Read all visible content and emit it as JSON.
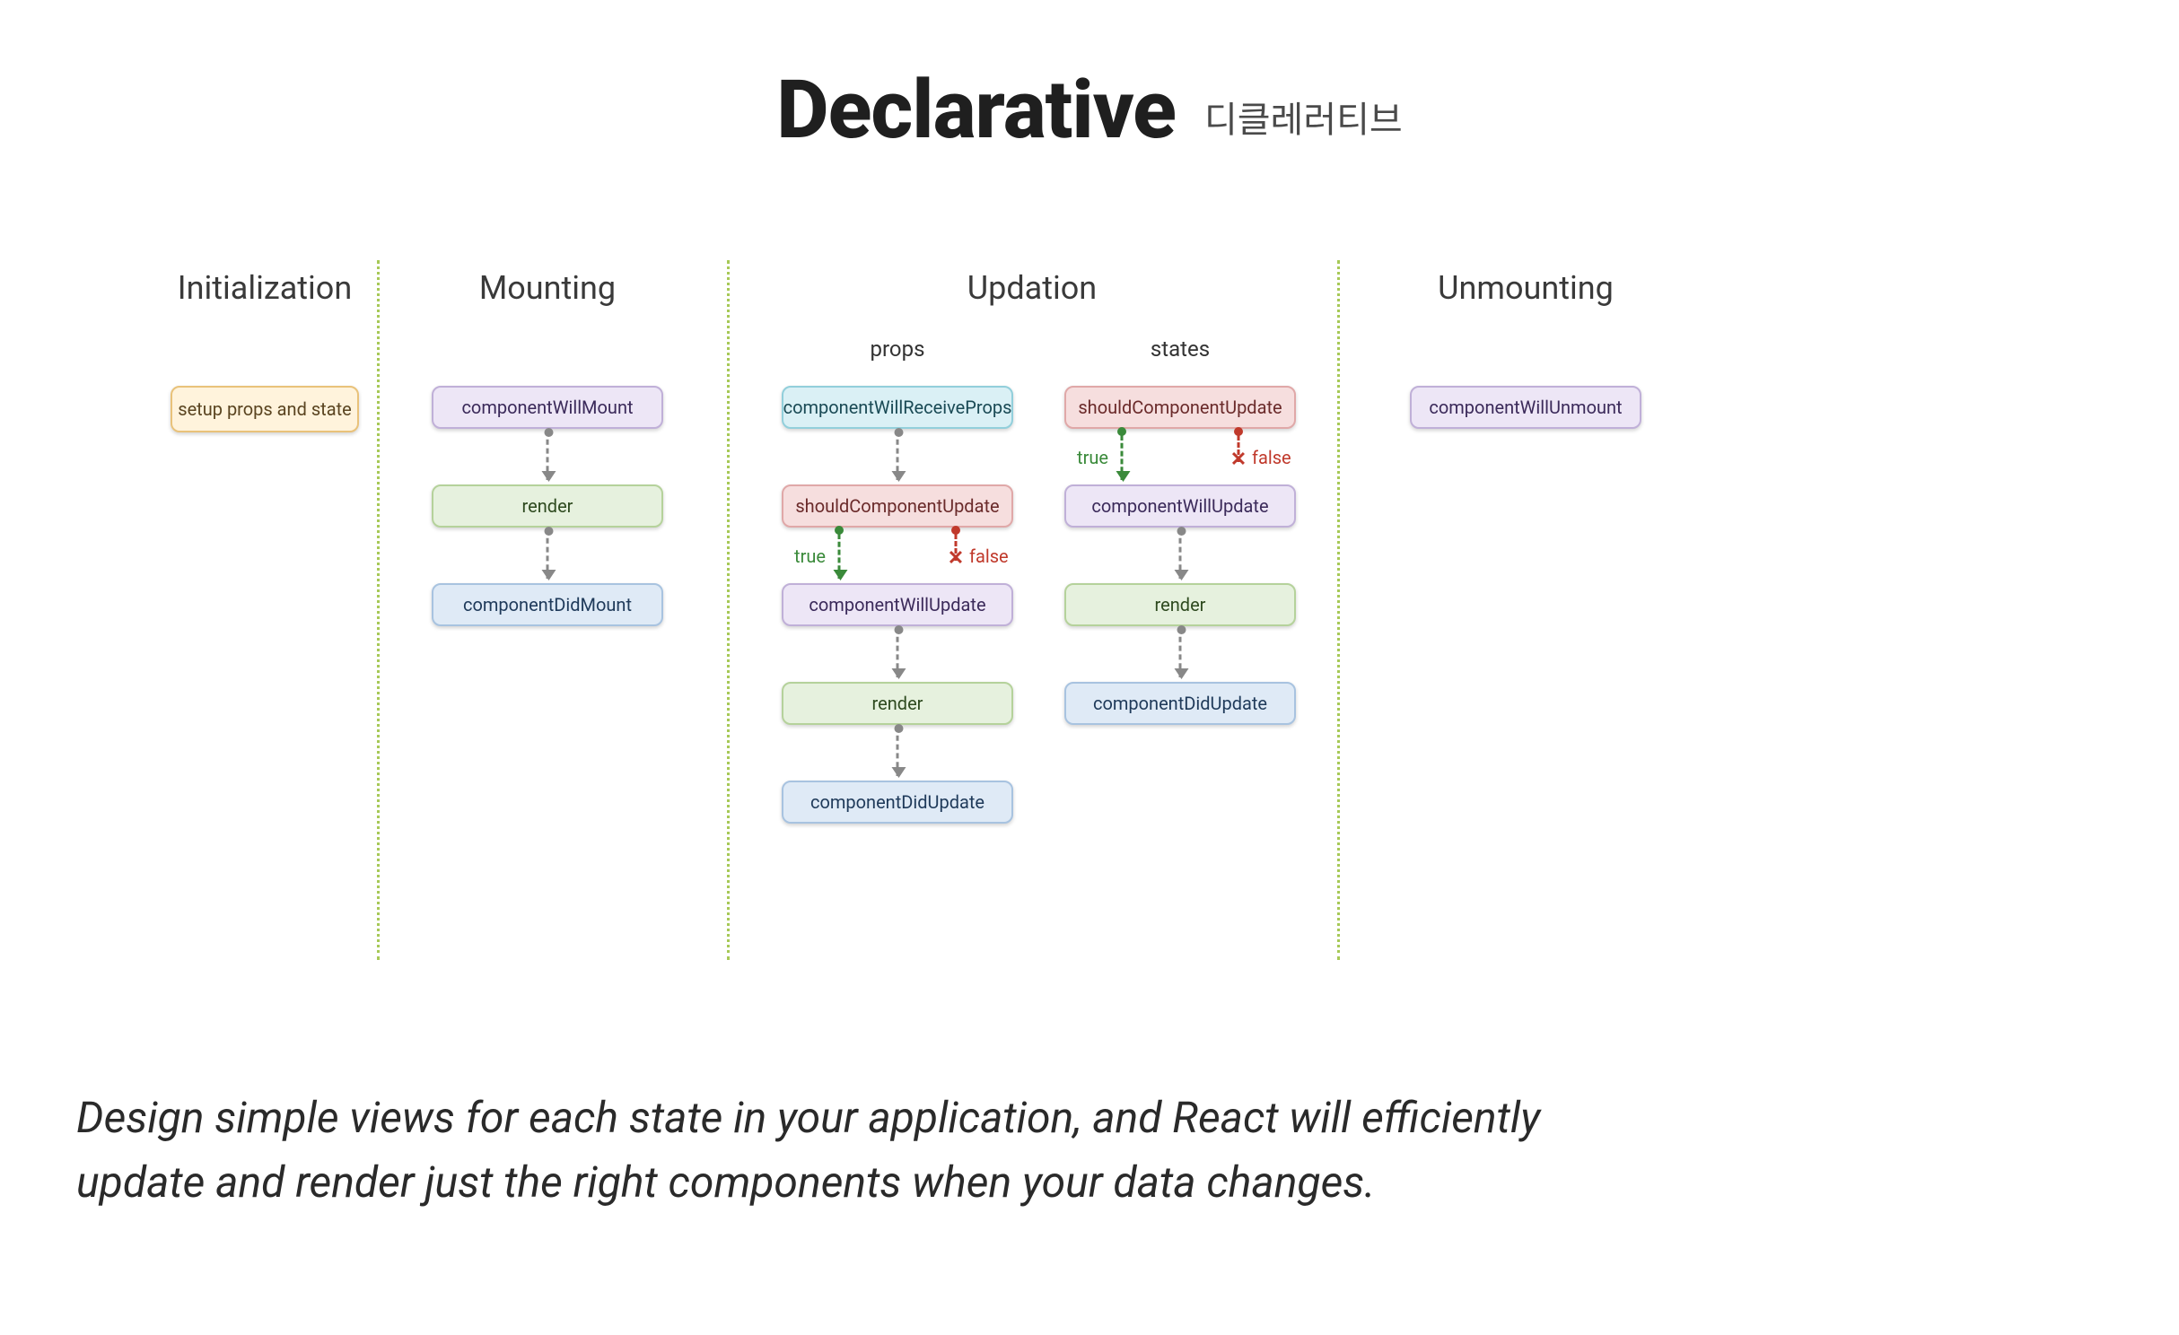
{
  "heading": {
    "main": "Declarative",
    "sub": "디클레러티브"
  },
  "columns": {
    "initialization": {
      "title": "Initialization"
    },
    "mounting": {
      "title": "Mounting"
    },
    "updation": {
      "title": "Updation",
      "sub_props": "props",
      "sub_states": "states"
    },
    "unmounting": {
      "title": "Unmounting"
    }
  },
  "nodes": {
    "setup": "setup props and state",
    "cwm": "componentWillMount",
    "render_m": "render",
    "cdm": "componentDidMount",
    "cwrp": "componentWillReceiveProps",
    "scu_p": "shouldComponentUpdate",
    "cwu_p": "componentWillUpdate",
    "render_p": "render",
    "cdu_p": "componentDidUpdate",
    "scu_s": "shouldComponentUpdate",
    "cwu_s": "componentWillUpdate",
    "render_s": "render",
    "cdu_s": "componentDidUpdate",
    "cwun": "componentWillUnmount"
  },
  "labels": {
    "true": "true",
    "false": "false"
  },
  "caption": "Design simple views for each state in your application, and React will efficiently update and render just the right components when your data changes."
}
